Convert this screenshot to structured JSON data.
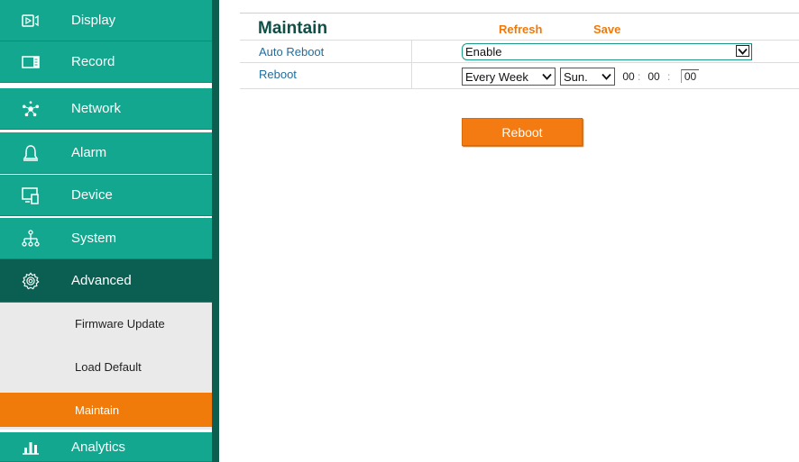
{
  "sidebar": {
    "items": [
      {
        "label": "Display",
        "icon": "display-icon"
      },
      {
        "label": "Record",
        "icon": "record-icon"
      },
      {
        "label": "Network",
        "icon": "network-icon"
      },
      {
        "label": "Alarm",
        "icon": "bell-icon"
      },
      {
        "label": "Device",
        "icon": "device-icon"
      },
      {
        "label": "System",
        "icon": "system-tree-icon"
      },
      {
        "label": "Advanced",
        "icon": "gear-icon"
      },
      {
        "label": "Analytics",
        "icon": "bar-chart-icon"
      }
    ],
    "submenu": [
      {
        "label": "Firmware Update"
      },
      {
        "label": "Load Default"
      },
      {
        "label": "Maintain"
      }
    ]
  },
  "main": {
    "title": "Maintain",
    "refresh_label": "Refresh",
    "save_label": "Save",
    "rows": {
      "auto_reboot": {
        "label": "Auto Reboot",
        "value": "Enable"
      },
      "reboot": {
        "label": "Reboot",
        "period": "Every Week",
        "day": "Sun.",
        "hour": "00",
        "minute": "00",
        "second": "00",
        "separator": ":"
      }
    },
    "reboot_button_label": "Reboot"
  },
  "colors": {
    "nav_bg": "#13a78f",
    "nav_active_bg": "#0b5f52",
    "accent_orange": "#f07a0a",
    "title_color": "#0e4f47",
    "label_color": "#1f6e9e"
  }
}
